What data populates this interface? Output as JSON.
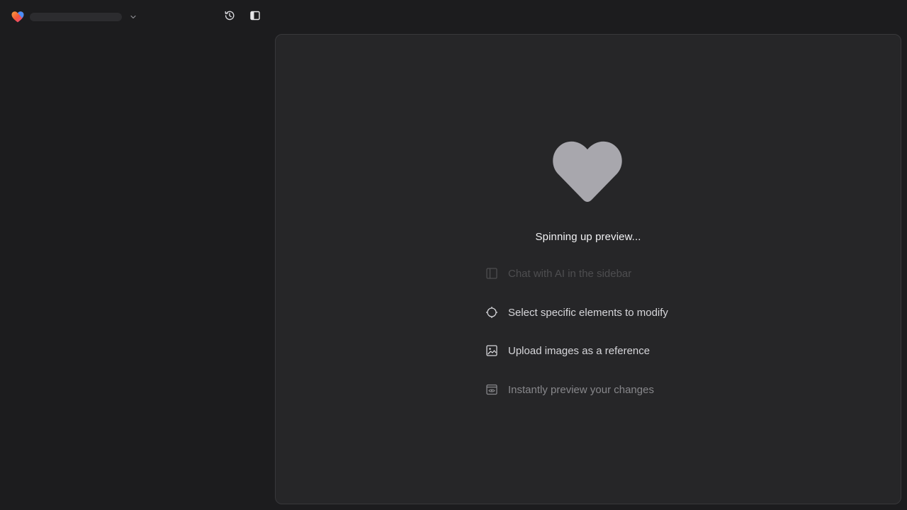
{
  "header": {
    "logo_icon": "heart-gradient-logo-icon",
    "project_chevron_icon": "chevron-down-icon",
    "history_icon": "history-icon",
    "sidebar_toggle_icon": "sidebar-toggle-icon"
  },
  "preview": {
    "heart_icon": "heart-icon",
    "heart_color": "#a8a7ad",
    "status": "Spinning up preview...",
    "tips": [
      {
        "icon": "sidebar-panel-icon",
        "label": "Chat with AI in the sidebar"
      },
      {
        "icon": "crosshair-icon",
        "label": "Select specific elements to modify"
      },
      {
        "icon": "image-icon",
        "label": "Upload images as a reference"
      },
      {
        "icon": "eye-window-icon",
        "label": "Instantly preview your changes"
      }
    ]
  },
  "colors": {
    "background": "#1c1c1e",
    "panel": "#262628",
    "panel_border": "#38383b",
    "logo_orange": "#f26b3a",
    "logo_blue": "#4b8df8"
  }
}
